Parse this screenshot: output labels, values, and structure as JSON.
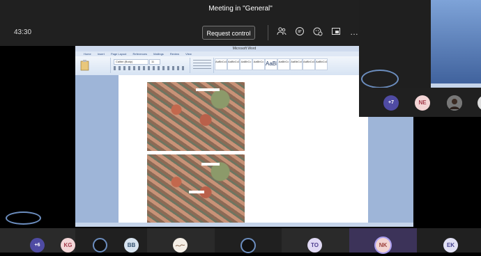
{
  "meeting": {
    "title": "Meeting in \"General\"",
    "timer": "43:30",
    "request_control": "Request control"
  },
  "toolbar": {
    "icons": [
      "people-icon",
      "chat-icon",
      "reactions-icon",
      "share-tray-icon",
      "more-icon"
    ],
    "more": "…"
  },
  "shared_screen": {
    "window_title": "Microsoft Word",
    "tabs": [
      "Home",
      "Insert",
      "Page Layout",
      "References",
      "Mailings",
      "Review",
      "View"
    ],
    "styles": [
      "AaBbCcDc",
      "AaBbCcDc",
      "AaBbCc",
      "AaBbCc",
      "AaBl",
      "AaBbCc",
      "AaBbCcl",
      "AaBbCcDc",
      "AaBbCcDc"
    ],
    "font_name": "Calibri (Body)",
    "font_size": "11",
    "style_label_big": "AaBl"
  },
  "pip": {
    "overflow_count": "+7",
    "avatar_initials": "NE"
  },
  "participants": {
    "overflow_count": "+6",
    "tiles": [
      {
        "initials": "KG",
        "bg": "#f3d6d8",
        "color": "#a33b4b"
      },
      {
        "initials": "BB",
        "bg": "#d7e3ef",
        "color": "#34526f"
      },
      {
        "initials": "TO",
        "bg": "#e0d9f4",
        "color": "#4e3e8f"
      },
      {
        "initials": "NK",
        "bg": "#f2d4d2",
        "color": "#9b3f3a"
      },
      {
        "initials": "EK",
        "bg": "#e1e0f4",
        "color": "#433f8d"
      }
    ]
  },
  "colors": {
    "accent": "#6c8ebf",
    "active_tile": "#3c3359",
    "bar": "#202020"
  }
}
